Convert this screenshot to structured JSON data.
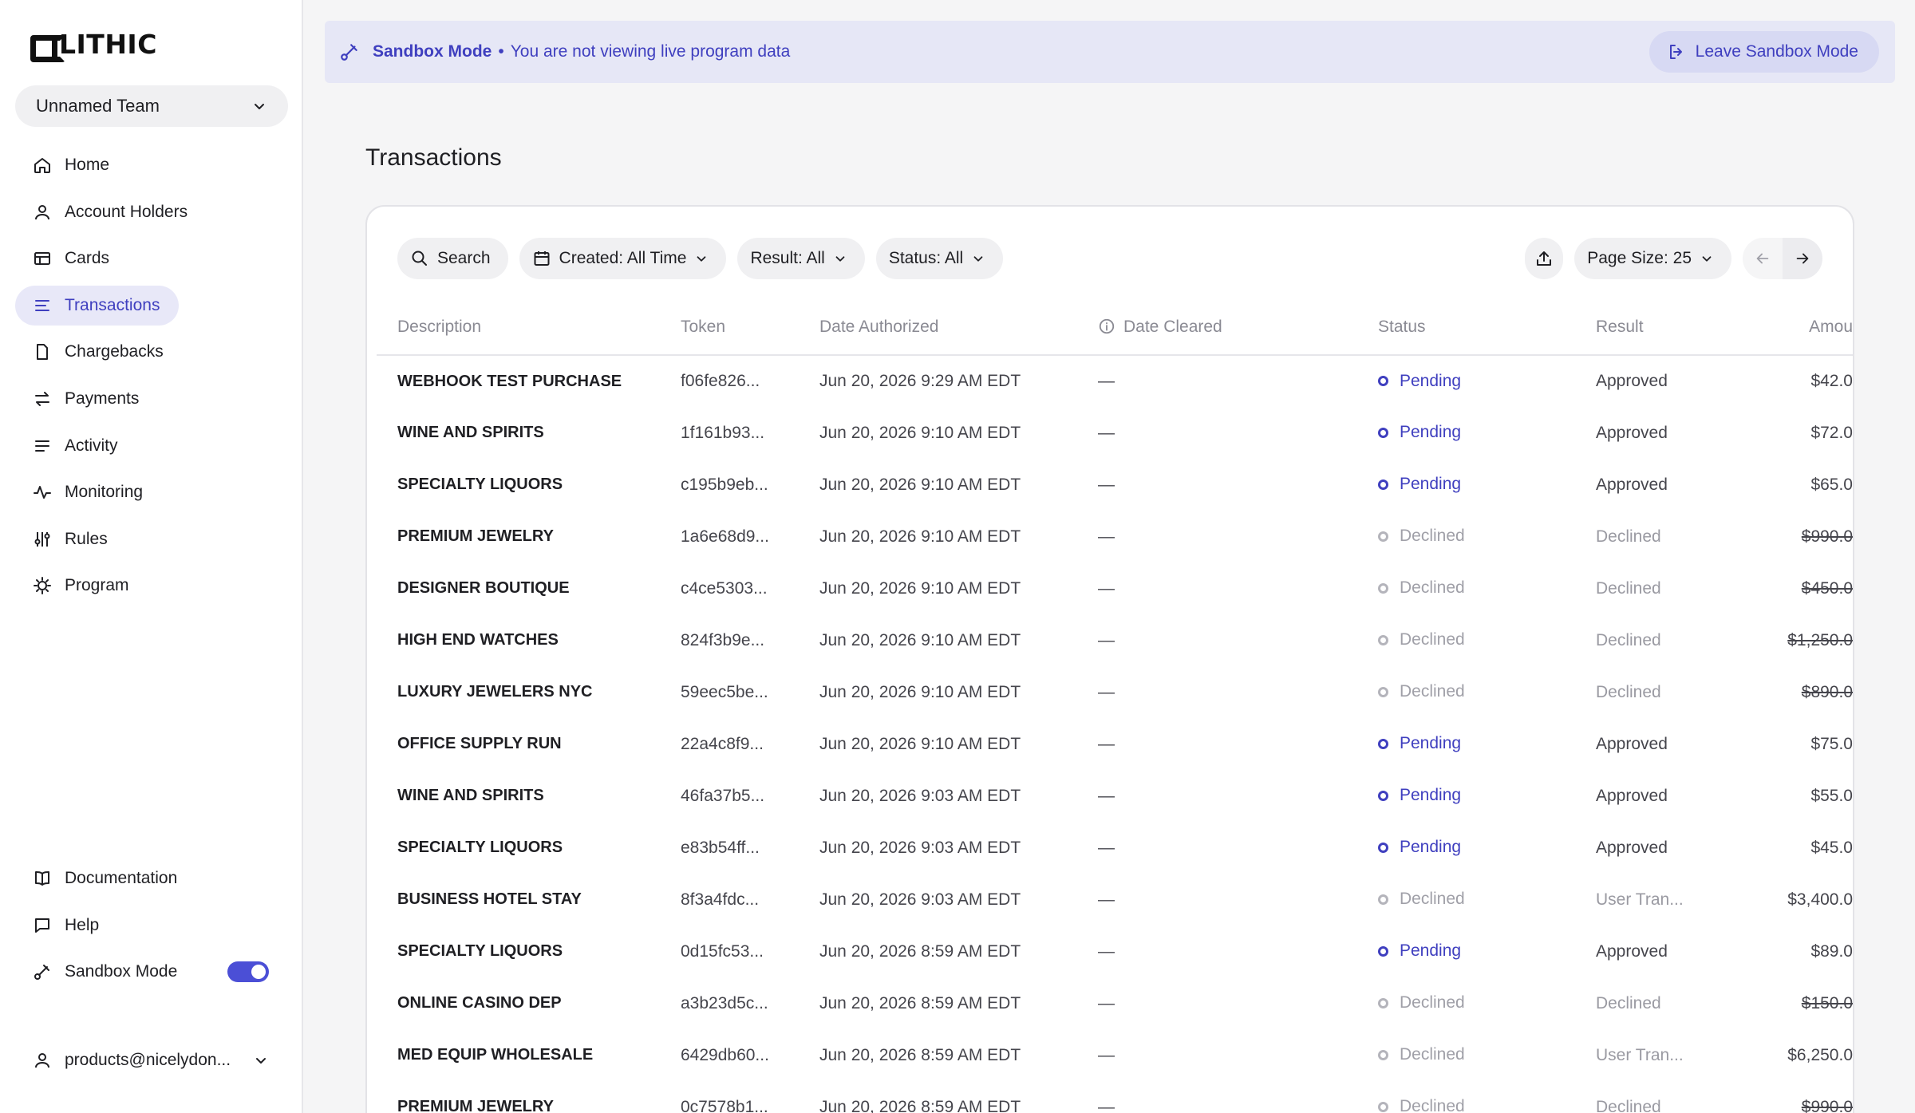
{
  "brand": {
    "name": "LITHIC"
  },
  "team": {
    "name": "Unnamed Team"
  },
  "nav": [
    {
      "label": "Home",
      "icon": "home-icon",
      "active": false
    },
    {
      "label": "Account Holders",
      "icon": "user-icon",
      "active": false
    },
    {
      "label": "Cards",
      "icon": "card-icon",
      "active": false
    },
    {
      "label": "Transactions",
      "icon": "list-icon",
      "active": true
    },
    {
      "label": "Chargebacks",
      "icon": "file-icon",
      "active": false
    },
    {
      "label": "Payments",
      "icon": "arrows-icon",
      "active": false
    },
    {
      "label": "Activity",
      "icon": "lines-icon",
      "active": false
    },
    {
      "label": "Monitoring",
      "icon": "pulse-icon",
      "active": false
    },
    {
      "label": "Rules",
      "icon": "sliders-icon",
      "active": false
    },
    {
      "label": "Program",
      "icon": "gear-icon",
      "active": false
    }
  ],
  "nav_bottom": {
    "documentation": "Documentation",
    "help": "Help",
    "sandbox": "Sandbox Mode"
  },
  "user": {
    "email": "products@nicelydon..."
  },
  "banner": {
    "title": "Sandbox Mode",
    "separator": "•",
    "message": "You are not viewing live program data",
    "leave_label": "Leave Sandbox Mode"
  },
  "page": {
    "title": "Transactions"
  },
  "toolbar": {
    "search_label": "Search",
    "created_filter": "Created: All Time",
    "result_filter": "Result: All",
    "status_filter": "Status: All",
    "page_size": "Page Size: 25"
  },
  "table": {
    "columns": {
      "description": "Description",
      "token": "Token",
      "date_authorized": "Date Authorized",
      "date_cleared": "Date Cleared",
      "status": "Status",
      "result": "Result",
      "amount": "Amou"
    },
    "rows": [
      {
        "description": "WEBHOOK TEST PURCHASE",
        "token": "f06fe826...",
        "date_authorized": "Jun 20, 2026 9:29 AM EDT",
        "date_cleared": "—",
        "status": "Pending",
        "result": "Approved",
        "amount": "$42.0"
      },
      {
        "description": "WINE AND SPIRITS",
        "token": "1f161b93...",
        "date_authorized": "Jun 20, 2026 9:10 AM EDT",
        "date_cleared": "—",
        "status": "Pending",
        "result": "Approved",
        "amount": "$72.0"
      },
      {
        "description": "SPECIALTY LIQUORS",
        "token": "c195b9eb...",
        "date_authorized": "Jun 20, 2026 9:10 AM EDT",
        "date_cleared": "—",
        "status": "Pending",
        "result": "Approved",
        "amount": "$65.0"
      },
      {
        "description": "PREMIUM JEWELRY",
        "token": "1a6e68d9...",
        "date_authorized": "Jun 20, 2026 9:10 AM EDT",
        "date_cleared": "—",
        "status": "Declined",
        "result": "Declined",
        "amount": "$990.0"
      },
      {
        "description": "DESIGNER BOUTIQUE",
        "token": "c4ce5303...",
        "date_authorized": "Jun 20, 2026 9:10 AM EDT",
        "date_cleared": "—",
        "status": "Declined",
        "result": "Declined",
        "amount": "$450.0"
      },
      {
        "description": "HIGH END WATCHES",
        "token": "824f3b9e...",
        "date_authorized": "Jun 20, 2026 9:10 AM EDT",
        "date_cleared": "—",
        "status": "Declined",
        "result": "Declined",
        "amount": "$1,250.0"
      },
      {
        "description": "LUXURY JEWELERS NYC",
        "token": "59eec5be...",
        "date_authorized": "Jun 20, 2026 9:10 AM EDT",
        "date_cleared": "—",
        "status": "Declined",
        "result": "Declined",
        "amount": "$890.0"
      },
      {
        "description": "OFFICE SUPPLY RUN",
        "token": "22a4c8f9...",
        "date_authorized": "Jun 20, 2026 9:10 AM EDT",
        "date_cleared": "—",
        "status": "Pending",
        "result": "Approved",
        "amount": "$75.0"
      },
      {
        "description": "WINE AND SPIRITS",
        "token": "46fa37b5...",
        "date_authorized": "Jun 20, 2026 9:03 AM EDT",
        "date_cleared": "—",
        "status": "Pending",
        "result": "Approved",
        "amount": "$55.0"
      },
      {
        "description": "SPECIALTY LIQUORS",
        "token": "e83b54ff...",
        "date_authorized": "Jun 20, 2026 9:03 AM EDT",
        "date_cleared": "—",
        "status": "Pending",
        "result": "Approved",
        "amount": "$45.0"
      },
      {
        "description": "BUSINESS HOTEL STAY",
        "token": "8f3a4fdc...",
        "date_authorized": "Jun 20, 2026 9:03 AM EDT",
        "date_cleared": "—",
        "status": "Declined",
        "result": "User Tran...",
        "amount": "$3,400.0"
      },
      {
        "description": "SPECIALTY LIQUORS",
        "token": "0d15fc53...",
        "date_authorized": "Jun 20, 2026 8:59 AM EDT",
        "date_cleared": "—",
        "status": "Pending",
        "result": "Approved",
        "amount": "$89.0"
      },
      {
        "description": "ONLINE CASINO DEP",
        "token": "a3b23d5c...",
        "date_authorized": "Jun 20, 2026 8:59 AM EDT",
        "date_cleared": "—",
        "status": "Declined",
        "result": "Declined",
        "amount": "$150.0"
      },
      {
        "description": "MED EQUIP WHOLESALE",
        "token": "6429db60...",
        "date_authorized": "Jun 20, 2026 8:59 AM EDT",
        "date_cleared": "—",
        "status": "Declined",
        "result": "User Tran...",
        "amount": "$6,250.0"
      },
      {
        "description": "PREMIUM JEWELRY",
        "token": "0c7578b1...",
        "date_authorized": "Jun 20, 2026 8:59 AM EDT",
        "date_cleared": "—",
        "status": "Declined",
        "result": "Declined",
        "amount": "$990.0"
      }
    ]
  },
  "colors": {
    "accent": "#3f3fbf",
    "banner_bg": "#e6e7f6",
    "toggle": "#4b4fd6",
    "muted": "#a0a0a8"
  }
}
